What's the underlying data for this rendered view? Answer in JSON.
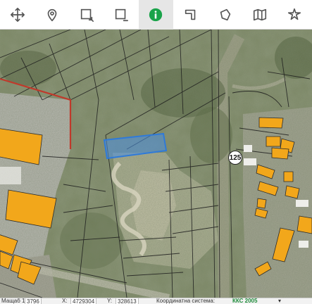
{
  "toolbar": {
    "tools": [
      {
        "icon": "move-icon",
        "active": false
      },
      {
        "icon": "location-pin-icon",
        "active": false
      },
      {
        "icon": "zoom-in-rectangle-icon",
        "active": false
      },
      {
        "icon": "zoom-out-rectangle-icon",
        "active": false
      },
      {
        "icon": "info-icon",
        "active": true
      },
      {
        "icon": "measure-length-icon",
        "active": false
      },
      {
        "icon": "measure-area-icon",
        "active": false
      },
      {
        "icon": "map-layers-icon",
        "active": false
      },
      {
        "icon": "pan-arrows-icon",
        "active": false
      }
    ],
    "accent_color": "#1aa34a"
  },
  "map": {
    "route_badge": "125",
    "selected_parcel_color": "#4a90e2",
    "building_color": "#f2a71b",
    "boundary_color": "#c0392b"
  },
  "status": {
    "scale_label": "Мащаб 1:",
    "scale_value": "3796",
    "x_label": "X:",
    "x_value": "4729304",
    "y_label": "Y:",
    "y_value": "328613",
    "crs_label": "Координатна система:",
    "crs_value": "ККС 2005"
  }
}
